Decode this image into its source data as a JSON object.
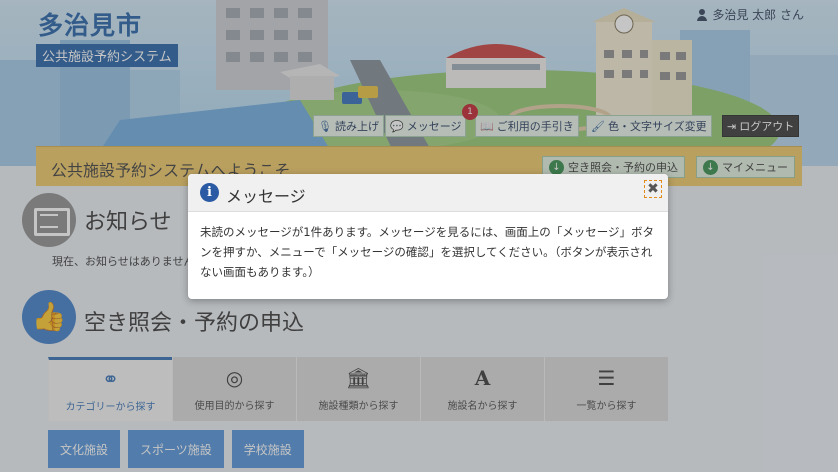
{
  "header": {
    "city": "多治見市",
    "system": "公共施設予約システム",
    "user": "多治見 太郎 さん"
  },
  "toolbar": {
    "read_aloud": "読み上げ",
    "messages": "メッセージ",
    "message_count": "1",
    "guide": "ご利用の手引き",
    "color_font": "色・文字サイズ変更",
    "logout": "ログアウト"
  },
  "welcome": {
    "text": "公共施設予約システムへようこそ",
    "availability_button": "空き照会・予約の申込",
    "my_menu_button": "マイメニュー"
  },
  "news": {
    "title": "お知らせ",
    "body": "現在、お知らせはありません"
  },
  "reservation": {
    "title": "空き照会・予約の申込",
    "tabs": [
      {
        "label": "カテゴリーから探す",
        "icon": "share-icon"
      },
      {
        "label": "使用目的から探す",
        "icon": "compass-icon"
      },
      {
        "label": "施設種類から探す",
        "icon": "bank-icon"
      },
      {
        "label": "施設名から探す",
        "icon": "font-icon"
      },
      {
        "label": "一覧から探す",
        "icon": "list-icon"
      }
    ],
    "categories": [
      "文化施設",
      "スポーツ施設",
      "学校施設"
    ]
  },
  "modal": {
    "title": "メッセージ",
    "body": "未読のメッセージが1件あります。メッセージを見るには、画面上の「メッセージ」ボタンを押すか、メニューで「メッセージの確認」を選択してください。（ボタンが表示されない画面もあります。）"
  },
  "colors": {
    "brand": "#1f5fa6",
    "welcome_bar": "#eec763",
    "category_button": "#4f90d7",
    "badge": "#c0202a"
  }
}
